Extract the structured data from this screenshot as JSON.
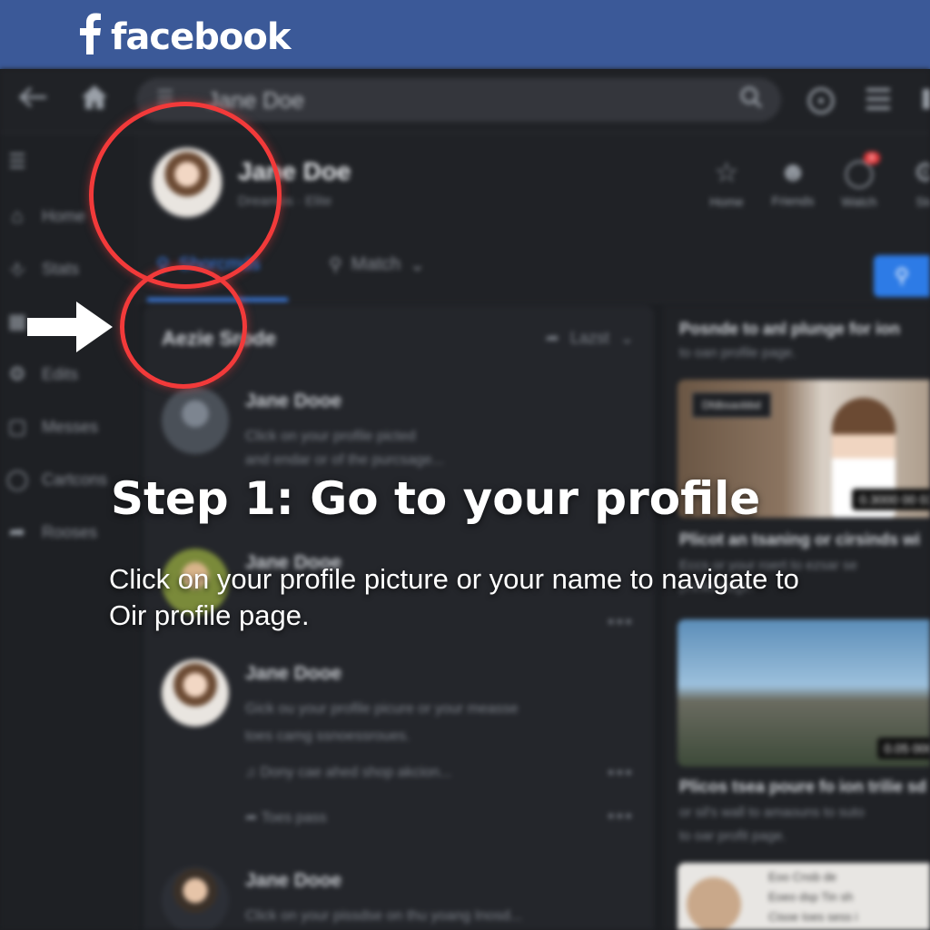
{
  "brand": {
    "name": "facebook",
    "color": "#3b5998",
    "logo_icon": "facebook-f-icon"
  },
  "topnav": {
    "back_icon": "back-arrow-icon",
    "home_icon": "home-icon",
    "search": {
      "value": "",
      "placeholder": "Jane Doe",
      "icon": "search-icon"
    },
    "right_icons": [
      "help-icon",
      "menu-icon"
    ]
  },
  "sidebar": {
    "items": [
      {
        "label": "Home",
        "icon": "home-icon"
      },
      {
        "label": "Stats",
        "icon": "stats-icon"
      },
      {
        "label": "",
        "icon": "grid-icon"
      },
      {
        "label": "Edits",
        "icon": "gear-icon"
      },
      {
        "label": "Messes",
        "icon": "square-icon"
      },
      {
        "label": "Cartcons",
        "icon": "bulb-icon"
      },
      {
        "label": "Rooses",
        "icon": "share-icon"
      }
    ]
  },
  "profile": {
    "name": "Jane Doe",
    "subtitle": "Dreamos · Elite",
    "header_tabs": [
      {
        "label": "Home",
        "icon": "star-icon"
      },
      {
        "label": "Friends",
        "icon": "friends-icon"
      },
      {
        "label": "Watch",
        "icon": "watch-icon",
        "badge": "6"
      },
      {
        "label": "Sto",
        "icon": "store-icon"
      }
    ],
    "tabs": [
      {
        "label": "Shorcmds",
        "active": true
      },
      {
        "label": "Match",
        "active": false
      }
    ]
  },
  "feed": {
    "heading": "Aezie Srode",
    "sort_label": "Lazst",
    "posts": [
      {
        "name": "Jane Dooe",
        "lines": [
          "Click on your profile picted",
          "and endar or of the purcsage..."
        ]
      },
      {
        "name": "Jane Dooe",
        "lines": []
      },
      {
        "name": "Jane Dooe",
        "lines": [
          "Gick ou your profile picure or your measse",
          "toes camg ssnoessroues."
        ],
        "action1": "Dony cae ahed shop akcion...",
        "action2": "Toes pass"
      },
      {
        "name": "Jane Dooe",
        "lines": [
          "Click on your pissdse on thu yoang Inosd..."
        ]
      }
    ]
  },
  "right": {
    "card1": {
      "title": "Posnde to anl plunge for ion",
      "line": "to oan profile page.",
      "tag": "Dfdbsaobbd",
      "time": "0.3000 00 03"
    },
    "card2": {
      "title": "Plicot an tsaning or cirsinds wi",
      "lines": [
        "Eccs or your roert to ezsar se",
        "profile page."
      ]
    },
    "card3": {
      "time": "0.05 000",
      "title": "Plicos tsea poure fo ion trilie sd",
      "lines": [
        "or sil's wall to amaouns to suto",
        "to oar profit page."
      ]
    },
    "card4": {
      "lines": [
        "Eoo Cnsb de",
        "Eoeo dsp Tin sh",
        "Cisoe Ioes sess i"
      ]
    }
  },
  "overlay": {
    "title": "Step 1: Go to your profile",
    "description": "Click on your profile picture or your name to navigate to Oir profile page.",
    "ring_color": "#f23a3a",
    "arrow_icon": "right-arrow-icon"
  }
}
